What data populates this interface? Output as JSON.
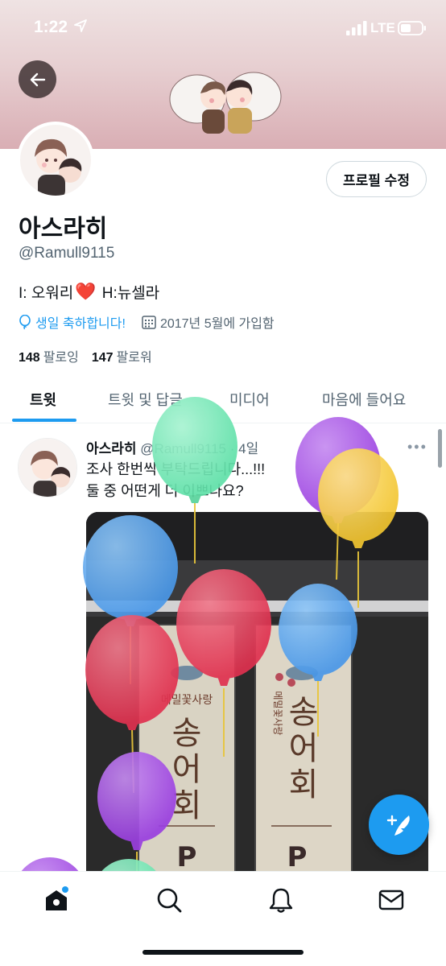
{
  "status_bar": {
    "time": "1:22",
    "network": "LTE"
  },
  "profile": {
    "display_name": "아스라히",
    "handle": "@Ramull9115",
    "bio_part1": "I: 오워리",
    "bio_heart": "❤️",
    "bio_part2": " H:뉴셀라",
    "birthday_text": "생일 축하합니다!",
    "joined_text": "2017년 5월에 가입함",
    "following_count": "148",
    "following_label": "팔로잉",
    "followers_count": "147",
    "followers_label": "팔로워",
    "edit_button_label": "프로필 수정"
  },
  "tabs": [
    {
      "label": "트윗"
    },
    {
      "label": "트윗 및 답글"
    },
    {
      "label": "미디어"
    },
    {
      "label": "마음에 들어요"
    }
  ],
  "tweet": {
    "author_name": "아스라히",
    "author_handle": "@Ramull9115",
    "separator": "·",
    "age": "4일",
    "more_label": "•••",
    "line1": "조사 한번씩 부탁드립니다...!!!",
    "line2": "둘 중 어떤게 더 이쁘나요?",
    "media_text": {
      "left_small": "메밀꽃사랑",
      "right_small": "메밀꽃사랑",
      "big1": "송",
      "big2": "어",
      "big3": "회",
      "letter": "P"
    }
  },
  "icons": {
    "back": "arrow-left-icon",
    "compose": "feather-plus-icon",
    "home": "home-icon",
    "search": "search-icon",
    "notifications": "bell-icon",
    "messages": "mail-icon",
    "birthday": "balloon-icon",
    "calendar": "calendar-icon"
  },
  "colors": {
    "accent": "#1d9bf0",
    "text": "#0f1419",
    "secondary": "#536471",
    "heart": "#e0245e"
  }
}
